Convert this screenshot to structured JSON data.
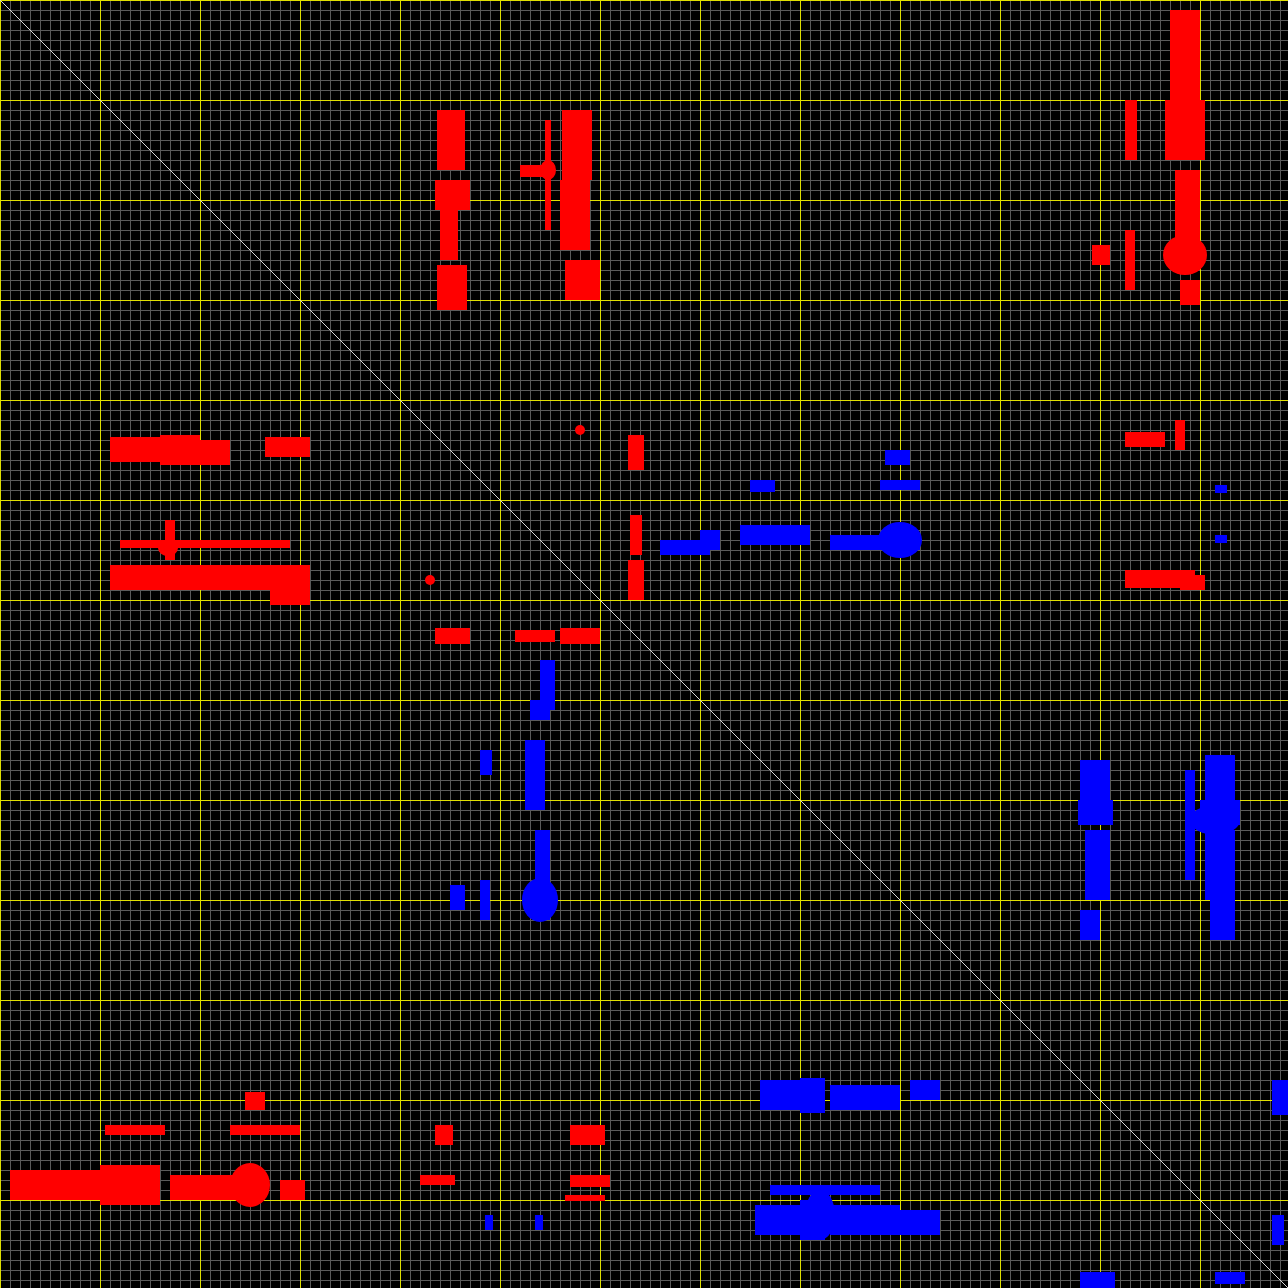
{
  "contact_map": {
    "signals": [
      {
        "color": "#ff0000"
      },
      {
        "color": "#0000ff"
      }
    ]
  }
}
